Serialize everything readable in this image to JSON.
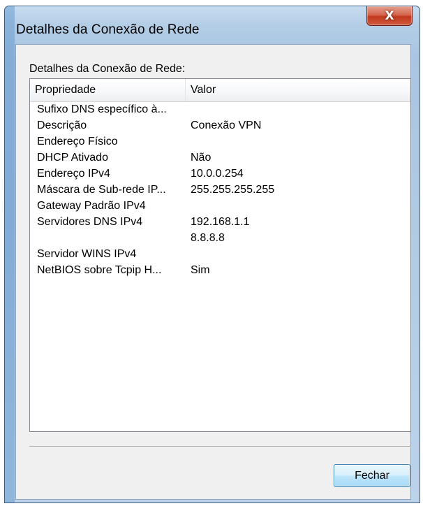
{
  "window": {
    "title": "Detalhes da Conexão de Rede",
    "close_glyph": "X"
  },
  "section_label": "Detalhes da Conexão de Rede:",
  "list": {
    "columns": [
      "Propriedade",
      "Valor"
    ],
    "rows": [
      {
        "property": "Sufixo DNS específico à...",
        "value": ""
      },
      {
        "property": "Descrição",
        "value": "Conexão VPN"
      },
      {
        "property": "Endereço Físico",
        "value": ""
      },
      {
        "property": "DHCP Ativado",
        "value": "Não"
      },
      {
        "property": "Endereço IPv4",
        "value": "10.0.0.254"
      },
      {
        "property": "Máscara de Sub-rede IP...",
        "value": "255.255.255.255"
      },
      {
        "property": "Gateway Padrão IPv4",
        "value": ""
      },
      {
        "property": "Servidores DNS IPv4",
        "value": "192.168.1.1"
      },
      {
        "property": "",
        "value": "8.8.8.8"
      },
      {
        "property": "Servidor WINS IPv4",
        "value": ""
      },
      {
        "property": "NetBIOS sobre Tcpip H...",
        "value": "Sim"
      }
    ]
  },
  "buttons": {
    "close_label": "Fechar"
  }
}
